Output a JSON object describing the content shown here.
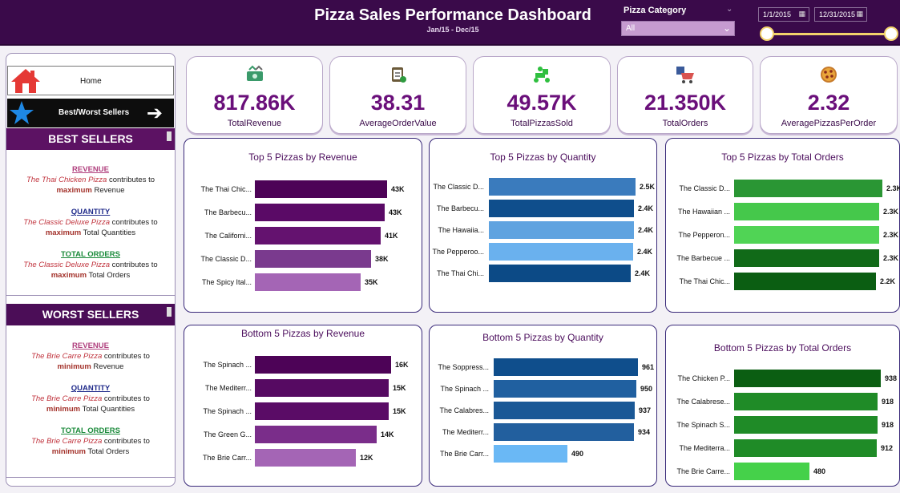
{
  "header": {
    "title": "Pizza Sales Performance Dashboard",
    "subtitle": "Jan/15 - Dec/15",
    "category_label": "Pizza Category",
    "category_value": "All",
    "date_start": "1/1/2015",
    "date_end": "12/31/2015"
  },
  "nav": {
    "home_label": "Home",
    "best_worst_label": "Best/Worst Sellers"
  },
  "best": {
    "heading": "BEST SELLERS",
    "revenue_h": "REVENUE",
    "revenue_name": "The Thai Chicken Pizza",
    "revenue_mid": " contributes to",
    "revenue_strong": "maximum",
    "revenue_end": " Revenue",
    "quantity_h": "QUANTITY",
    "quantity_name": "The Classic Deluxe Pizza",
    "quantity_mid": " contributes to",
    "quantity_strong": "maximum",
    "quantity_end": " Total Quantities",
    "orders_h": "TOTAL ORDERS",
    "orders_name": "The Classic Deluxe Pizza",
    "orders_mid": " contributes to",
    "orders_strong": "maximum",
    "orders_end": " Total Orders"
  },
  "worst": {
    "heading": "WORST SELLERS",
    "revenue_h": "REVENUE",
    "revenue_name": "The Brie Carre Pizza",
    "revenue_mid": " contributes to",
    "revenue_strong": "minimum",
    "revenue_end": " Revenue",
    "quantity_h": "QUANTITY",
    "quantity_name": "The Brie Carre Pizza",
    "quantity_mid": " contributes to",
    "quantity_strong": "minimum",
    "quantity_end": " Total Quantities",
    "orders_h": "TOTAL ORDERS",
    "orders_name": "The Brie Carre Pizza",
    "orders_mid": " contributes to",
    "orders_strong": "minimum",
    "orders_end": " Total Orders"
  },
  "kpis": [
    {
      "value": "817.86K",
      "label": "TotalRevenue",
      "icon": "money-icon"
    },
    {
      "value": "38.31",
      "label": "AverageOrderValue",
      "icon": "clipboard-icon"
    },
    {
      "value": "49.57K",
      "label": "TotalPizzasSold",
      "icon": "delivery-icon"
    },
    {
      "value": "21.350K",
      "label": "TotalOrders",
      "icon": "cart-icon"
    },
    {
      "value": "2.32",
      "label": "AveragePizzasPerOrder",
      "icon": "pizza-icon"
    }
  ],
  "colors": {
    "purple_dark": "#4d0357",
    "purple_mid": "#7a2d8a",
    "purple_light": "#a465b5",
    "blue_dark": "#0f4e8c",
    "blue_mid": "#2d6fb0",
    "blue_light": "#6ab1ee",
    "green_dark": "#0b5e12",
    "green_mid": "#1f8b27",
    "green_light": "#45d14a"
  },
  "chart_data": [
    {
      "type": "bar",
      "title": "Top 5 Pizzas by Revenue",
      "categories": [
        "The Thai Chic...",
        "The Barbecu...",
        "The Californi...",
        "The Classic D...",
        "The Spicy Ital..."
      ],
      "values": [
        43434,
        42768,
        41410,
        38181,
        34832
      ],
      "labels": [
        "43K",
        "43K",
        "41K",
        "38K",
        "35K"
      ],
      "colors": [
        "#4d0357",
        "#5a0a66",
        "#64126f",
        "#7a3a8e",
        "#a465b5"
      ]
    },
    {
      "type": "bar",
      "title": "Top 5 Pizzas by Quantity",
      "categories": [
        "The Classic D...",
        "The Barbecu...",
        "The Hawaiia...",
        "The Pepperoo...",
        "The Thai Chi..."
      ],
      "values": [
        2453,
        2432,
        2422,
        2418,
        2371
      ],
      "labels": [
        "2.5K",
        "2.4K",
        "2.4K",
        "2.4K",
        "2.4K"
      ],
      "colors": [
        "#3a7bbd",
        "#0f4e8c",
        "#5fa3e0",
        "#6ab1ee",
        "#0c4a86"
      ]
    },
    {
      "type": "bar",
      "title": "Top 5 Pizzas by Total Orders",
      "categories": [
        "The Classic D...",
        "The Hawaiian ...",
        "The Pepperon...",
        "The Barbecue ...",
        "The Thai Chic..."
      ],
      "values": [
        2329,
        2280,
        2278,
        2273,
        2225
      ],
      "labels": [
        "2.3K",
        "2.3K",
        "2.3K",
        "2.3K",
        "2.2K"
      ],
      "colors": [
        "#2a9634",
        "#45c84b",
        "#50d455",
        "#116a18",
        "#0b5e12"
      ]
    },
    {
      "type": "bar",
      "title": "Bottom 5 Pizzas by Revenue",
      "categories": [
        "The Spinach ...",
        "The Mediterr...",
        "The Spinach ...",
        "The Green G...",
        "The Brie Carr..."
      ],
      "values": [
        15596,
        15360,
        15277,
        13955,
        11588
      ],
      "labels": [
        "16K",
        "15K",
        "15K",
        "14K",
        "12K"
      ],
      "colors": [
        "#4d0357",
        "#560a62",
        "#5a0c66",
        "#7a2d8a",
        "#a465b5"
      ]
    },
    {
      "type": "bar",
      "title": "Bottom 5 Pizzas by Quantity",
      "categories": [
        "The Soppress...",
        "The Spinach ...",
        "The Calabres...",
        "The Mediterr...",
        "The Brie Carr..."
      ],
      "values": [
        961,
        950,
        937,
        934,
        490
      ],
      "labels": [
        "961",
        "950",
        "937",
        "934",
        "490"
      ],
      "colors": [
        "#0f4e8c",
        "#2060a0",
        "#1a5896",
        "#225f9e",
        "#6ab8f5"
      ]
    },
    {
      "type": "bar",
      "title": "Bottom 5 Pizzas by Total Orders",
      "categories": [
        "The Chicken P...",
        "The Calabrese...",
        "The Spinach S...",
        "The Mediterra...",
        "The Brie Carre..."
      ],
      "values": [
        938,
        918,
        918,
        912,
        480
      ],
      "labels": [
        "938",
        "918",
        "918",
        "912",
        "480"
      ],
      "colors": [
        "#0b5e12",
        "#1f8b27",
        "#1f8b27",
        "#1f8b27",
        "#45d14a"
      ]
    }
  ]
}
